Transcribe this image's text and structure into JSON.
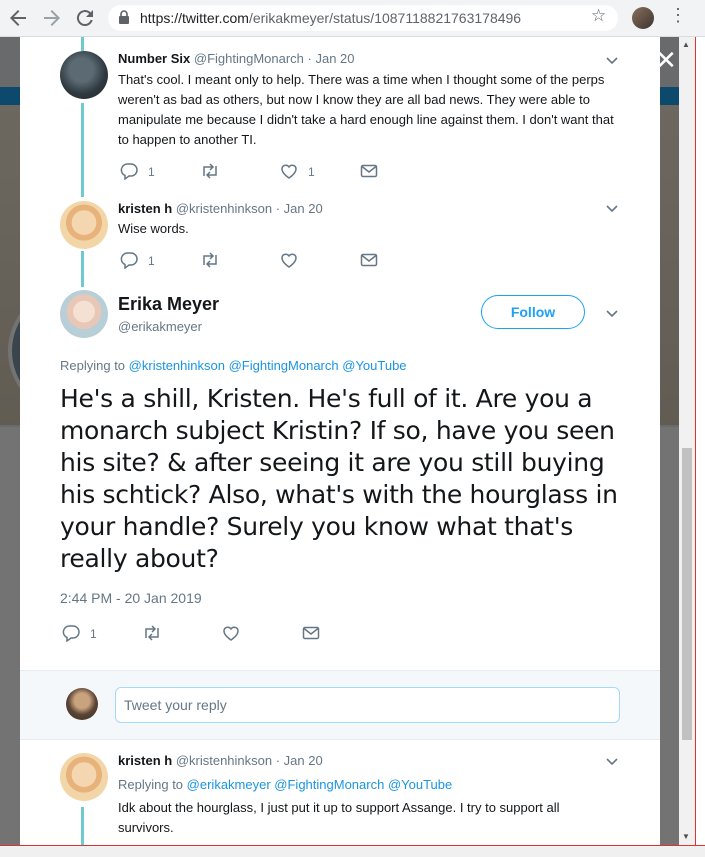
{
  "browser": {
    "url_host": "https://twitter.com",
    "url_path": "/erikakmeyer/status/1087118821763178496",
    "icons": [
      "back-arrow-icon",
      "forward-arrow-icon",
      "reload-icon",
      "lock-icon",
      "star-icon",
      "profile-avatar",
      "menu-dots-icon"
    ]
  },
  "modal": {
    "close_label": "✕",
    "tweets": [
      {
        "name": "Number Six",
        "handle": "@FightingMonarch",
        "date": "· Jan 20",
        "text": "That's cool. I meant only to help. There was a time when I thought some of the perps weren't as bad as others, but now I know they are all bad news. They were able to manipulate me because I didn't take a hard enough line against them. I don't want that to happen to another TI.",
        "reply_count": "1",
        "retweet_count": "",
        "like_count": "1"
      },
      {
        "name": "kristen h",
        "handle": "@kristenhinkson",
        "date": "· Jan 20",
        "text": "Wise words.",
        "reply_count": "1",
        "retweet_count": "",
        "like_count": ""
      }
    ],
    "main_tweet": {
      "name": "Erika Meyer",
      "handle": "@erikakmeyer",
      "follow_label": "Follow",
      "replying_prefix": "Replying to",
      "replying_to": [
        "@kristenhinkson",
        "@FightingMonarch",
        "@YouTube"
      ],
      "text": "He's a shill, Kristen. He's full of it. Are you a monarch subject Kristin? If so, have you seen his site? & after seeing it are you still buying his schtick? Also, what's with the hourglass in your handle? Surely you know what that's really about?",
      "timestamp": "2:44 PM - 20 Jan 2019",
      "reply_count": "1",
      "retweet_count": "",
      "like_count": ""
    },
    "reply_box": {
      "placeholder": "Tweet your reply"
    },
    "reply_tweet": {
      "name": "kristen h",
      "handle": "@kristenhinkson",
      "date": "· Jan 20",
      "replying_prefix": "Replying to",
      "replying_to": [
        "@erikakmeyer",
        "@FightingMonarch",
        "@YouTube"
      ],
      "text": "Idk about the hourglass, I just put it up to support Assange. I try to support all survivors."
    }
  },
  "colors": {
    "accent": "#1da1f2",
    "link": "#1b95e0",
    "thread_line": "#71c9d0",
    "muted_text": "#657786",
    "primary_text": "#14171a"
  }
}
